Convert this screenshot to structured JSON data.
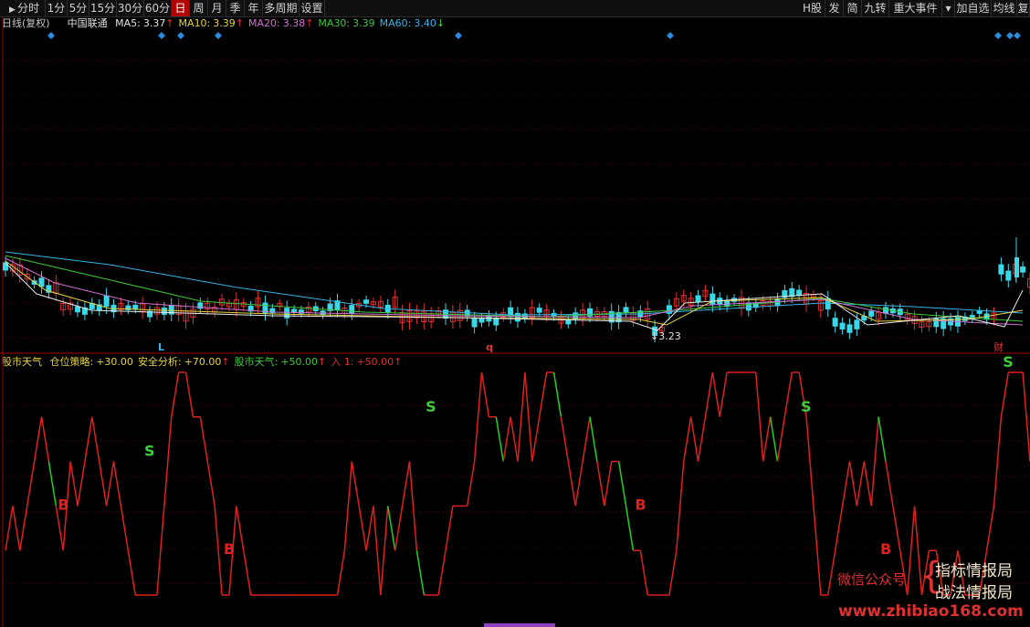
{
  "toolbar": {
    "left_items": [
      {
        "label": "分时",
        "icon": "play-icon"
      },
      {
        "label": "1分"
      },
      {
        "label": "5分"
      },
      {
        "label": "15分"
      },
      {
        "label": "30分"
      },
      {
        "label": "60分"
      },
      {
        "label": "日",
        "active": true
      },
      {
        "label": "周"
      },
      {
        "label": "月"
      },
      {
        "label": "季"
      },
      {
        "label": "年"
      },
      {
        "label": "多周期"
      },
      {
        "label": "设置"
      }
    ],
    "right_items": [
      {
        "label": "H股"
      },
      {
        "label": "发"
      },
      {
        "label": "简"
      },
      {
        "label": "九转"
      },
      {
        "label": "重大事件"
      },
      {
        "label": "▾"
      },
      {
        "label": "加自选"
      },
      {
        "label": "均线"
      },
      {
        "label": "复"
      }
    ]
  },
  "header": {
    "period": "日线(复权)",
    "stock": "中国联通",
    "ma": [
      {
        "label": "MA5:",
        "value": "3.37",
        "arrow": "↑",
        "color": "#e0e0e0"
      },
      {
        "label": "MA10:",
        "value": "3.39",
        "arrow": "↑",
        "color": "#e6d23c"
      },
      {
        "label": "MA20:",
        "value": "3.38",
        "arrow": "↑",
        "color": "#d070d0"
      },
      {
        "label": "MA30:",
        "value": "3.39",
        "arrow": "",
        "color": "#3cc83c"
      },
      {
        "label": "MA60:",
        "value": "3.40",
        "arrow": "↓",
        "color": "#38b4e6"
      }
    ]
  },
  "price_labels": {
    "low_value": "3.23",
    "markers": [
      "L",
      "q",
      "财"
    ]
  },
  "indicator": {
    "name": "股市天气",
    "items": [
      {
        "label": "仓位策略:",
        "value": "+30.00",
        "arrow": "",
        "color": "#e6d23c"
      },
      {
        "label": "安全分析:",
        "value": "+70.00",
        "arrow": "↑",
        "color": "#e6d23c"
      },
      {
        "label": "股市天气:",
        "value": "+50.00",
        "arrow": "↑",
        "color": "#3cc83c"
      },
      {
        "label": "入 1:",
        "value": "+50.00",
        "arrow": "↑",
        "color": "#e03030"
      }
    ],
    "signals": [
      "B",
      "S",
      "B",
      "S",
      "B",
      "S",
      "B",
      "S"
    ]
  },
  "watermark": {
    "wechat": "微信公众号",
    "line1": "指标情报局",
    "line2": "战法情报局",
    "url": "www.zhibiao168.com"
  },
  "chart_data": {
    "type": "line",
    "title": "股市天气",
    "x_count": 143,
    "ylim": [
      0,
      100
    ],
    "series": [
      {
        "name": "股市天气",
        "color_up": "#e02020",
        "color_down": "#22d022"
      }
    ],
    "markers": [
      {
        "label": "B",
        "index": 8,
        "value": 40
      },
      {
        "label": "B",
        "index": 31,
        "value": 20
      },
      {
        "label": "S",
        "index": 20,
        "value": 60
      },
      {
        "label": "S",
        "index": 59,
        "value": 80
      },
      {
        "label": "B",
        "index": 88,
        "value": 40
      },
      {
        "label": "S",
        "index": 111,
        "value": 80
      },
      {
        "label": "B",
        "index": 122,
        "value": 20
      },
      {
        "label": "S",
        "index": 139,
        "value": 100
      }
    ],
    "price": {
      "type": "candlestick",
      "min_value": 3.23,
      "ma_labels": [
        "MA5",
        "MA10",
        "MA20",
        "MA30",
        "MA60"
      ]
    }
  }
}
